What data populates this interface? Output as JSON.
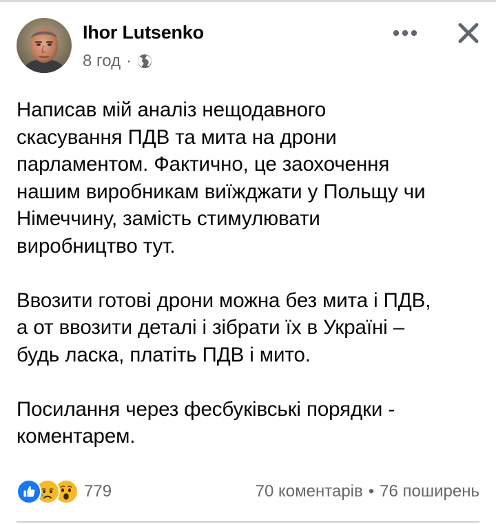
{
  "post": {
    "author": "Ihor Lutsenko",
    "time": "8 год",
    "separator": "·",
    "audience_icon": "globe-icon",
    "paragraphs": [
      {
        "lines": [
          "Написав мій аналіз нещодавного",
          "скасування ПДВ та мита на дрони",
          "парламентом. Фактично, це заохочення",
          "нашим виробникам виїжджати у Польщу чи",
          "Німеччину, замість стимулювати",
          "виробництво тут."
        ]
      },
      {
        "lines": [
          "Ввозити готові дрони можна без мита і ПДВ,",
          "а от ввозити деталі і зібрати їх в Україні –",
          "будь ласка, платіть ПДВ і мито."
        ]
      },
      {
        "lines": [
          "Посилання через фесбуківські порядки -",
          "коментарем."
        ]
      }
    ]
  },
  "header": {
    "more_icon": "more-horizontal-icon",
    "close_icon": "close-icon"
  },
  "footer": {
    "reaction_icons": [
      "like-icon",
      "sad-icon",
      "wow-icon"
    ],
    "reaction_count": "779",
    "comments": "70 коментарів",
    "stats_separator": "•",
    "shares": "76 поширень"
  },
  "colors": {
    "primary_text": "#050505",
    "secondary_text": "#65676b",
    "like_blue": "#1877f2",
    "reaction_yellow": "#f7b928",
    "divider": "#ced0d4"
  }
}
